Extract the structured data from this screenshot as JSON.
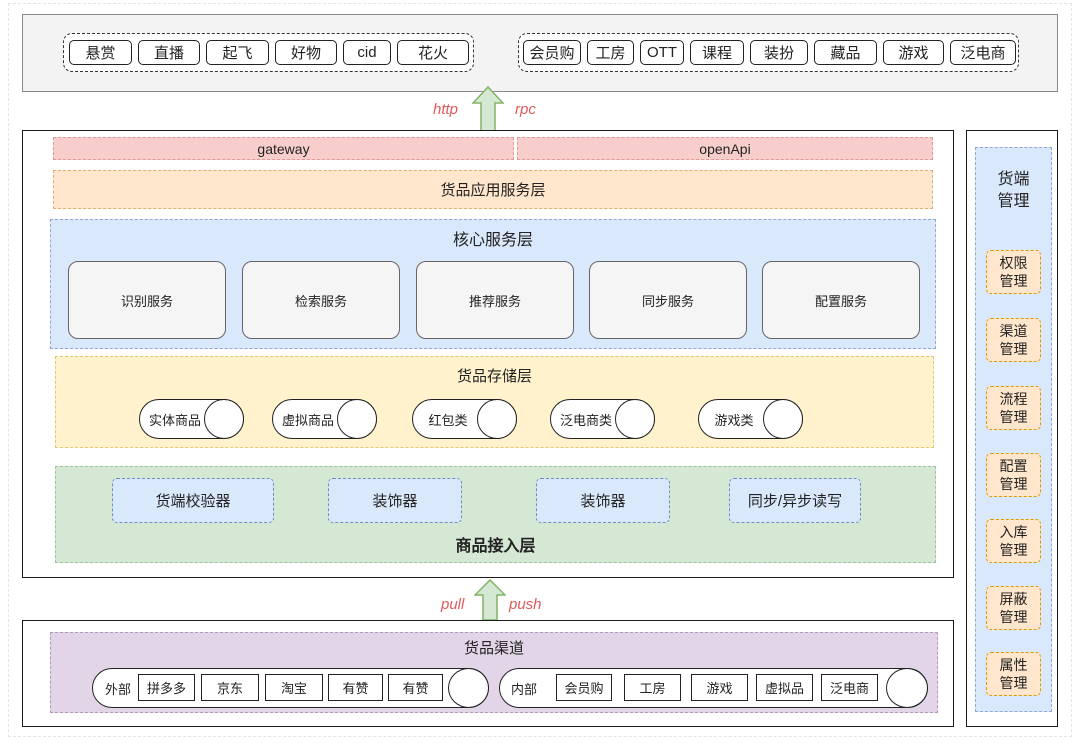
{
  "top_bar": {
    "left_apps": [
      "悬赏",
      "直播",
      "起飞",
      "好物",
      "cid",
      "花火"
    ],
    "right_apps": [
      "会员购",
      "工房",
      "OTT",
      "课程",
      "装扮",
      "藏品",
      "游戏",
      "泛电商"
    ]
  },
  "top_arrow": {
    "left_label": "http",
    "right_label": "rpc"
  },
  "main": {
    "gateway": "gateway",
    "open_api": "openApi",
    "app_service_layer": "货品应用服务层",
    "core_layer": {
      "title": "核心服务层",
      "services": [
        "识别服务",
        "检索服务",
        "推荐服务",
        "同步服务",
        "配置服务"
      ]
    },
    "storage_layer": {
      "title": "货品存储层",
      "stores": [
        "实体商品",
        "虚拟商品",
        "红包类",
        "泛电商类",
        "游戏类"
      ]
    },
    "access_layer": {
      "title": "商品接入层",
      "components": [
        "货端校验器",
        "装饰器",
        "装饰器",
        "同步/异步读写"
      ]
    }
  },
  "bottom_arrow": {
    "left_label": "pull",
    "right_label": "push"
  },
  "channel": {
    "title": "货品渠道",
    "external": {
      "label": "外部",
      "items": [
        "拼多多",
        "京东",
        "淘宝",
        "有赞",
        "有赞"
      ]
    },
    "internal": {
      "label": "内部",
      "items": [
        "会员购",
        "工房",
        "游戏",
        "虚拟品",
        "泛电商"
      ]
    }
  },
  "management": {
    "title": "货端管理",
    "items": [
      "权限管理",
      "渠道管理",
      "流程管理",
      "配置管理",
      "入库管理",
      "屏蔽管理",
      "属性管理"
    ]
  },
  "colors": {
    "top-bar-fill": "#f3f3f3",
    "gateway-fill": "#f8cecc",
    "app-layer-fill": "#ffe6cc",
    "core-layer-fill": "#dae8fc",
    "storage-layer-fill": "#fff2cc",
    "access-layer-fill": "#d5e8d4",
    "channel-layer-fill": "#e1d5e7",
    "arrow-fill": "#d5e8d4",
    "arrow-stroke": "#82b366",
    "arrow-label": "#e05a5a"
  }
}
